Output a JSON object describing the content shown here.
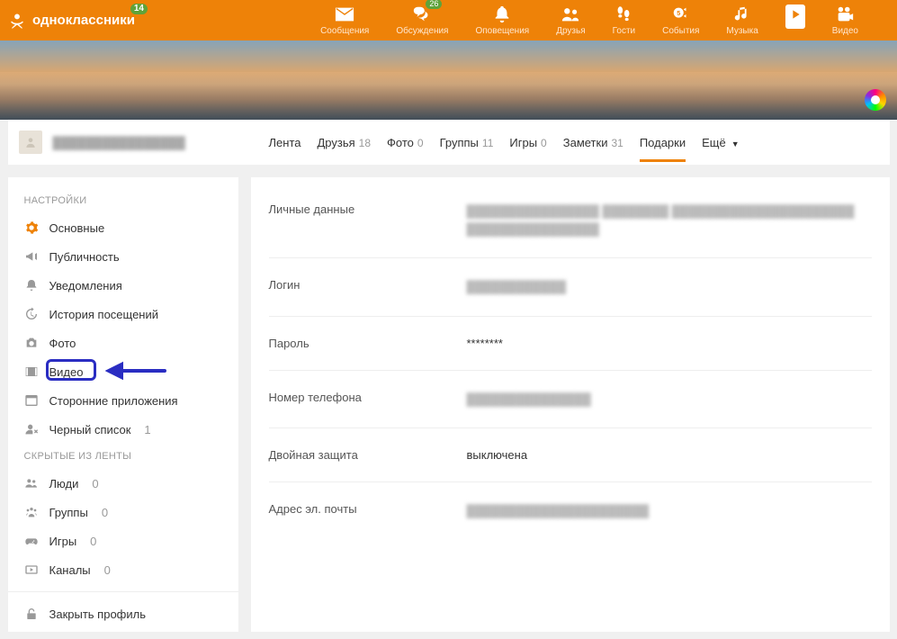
{
  "header": {
    "logo_text": "одноклассники",
    "logo_badge": "14",
    "nav": [
      {
        "id": "messages",
        "label": "Сообщения",
        "badge": null
      },
      {
        "id": "discussions",
        "label": "Обсуждения",
        "badge": "26"
      },
      {
        "id": "notifications",
        "label": "Оповещения",
        "badge": null
      },
      {
        "id": "friends",
        "label": "Друзья",
        "badge": null
      },
      {
        "id": "guests",
        "label": "Гости",
        "badge": null
      },
      {
        "id": "events",
        "label": "События",
        "badge": null
      },
      {
        "id": "music",
        "label": "Музыка",
        "badge": null
      },
      {
        "id": "videonav",
        "label": "",
        "badge": null
      },
      {
        "id": "video",
        "label": "Видео",
        "badge": null
      }
    ]
  },
  "profile": {
    "name": "████████████████"
  },
  "tabs": [
    {
      "label": "Лента",
      "count": null
    },
    {
      "label": "Друзья",
      "count": "18"
    },
    {
      "label": "Фото",
      "count": "0"
    },
    {
      "label": "Группы",
      "count": "11"
    },
    {
      "label": "Игры",
      "count": "0"
    },
    {
      "label": "Заметки",
      "count": "31"
    },
    {
      "label": "Подарки",
      "count": null,
      "active": true
    },
    {
      "label": "Ещё",
      "count": null,
      "more": true
    }
  ],
  "sidebar": {
    "settings_heading": "НАСТРОЙКИ",
    "hidden_heading": "СКРЫТЫЕ ИЗ ЛЕНТЫ",
    "items": {
      "main": "Основные",
      "public": "Публичность",
      "notify": "Уведомления",
      "history": "История посещений",
      "photo": "Фото",
      "video": "Видео",
      "thirdparty": "Сторонние приложения",
      "blacklist": "Черный список",
      "blacklist_count": "1",
      "people": "Люди",
      "people_count": "0",
      "groups": "Группы",
      "groups_count": "0",
      "games": "Игры",
      "games_count": "0",
      "channels": "Каналы",
      "channels_count": "0",
      "close": "Закрыть профиль"
    }
  },
  "settings_rows": {
    "personal": {
      "label": "Личные данные",
      "value": "████████████████  ████████  ██████████████████████ ████████████████",
      "redacted": true
    },
    "login": {
      "label": "Логин",
      "value": "████████████",
      "redacted": true
    },
    "password": {
      "label": "Пароль",
      "value": "********",
      "redacted": false
    },
    "phone": {
      "label": "Номер телефона",
      "value": "███████████████",
      "redacted": true
    },
    "twofa": {
      "label": "Двойная защита",
      "value": "выключена",
      "redacted": false
    },
    "email": {
      "label": "Адрес эл. почты",
      "value": "██████████████████████",
      "redacted": true
    }
  }
}
